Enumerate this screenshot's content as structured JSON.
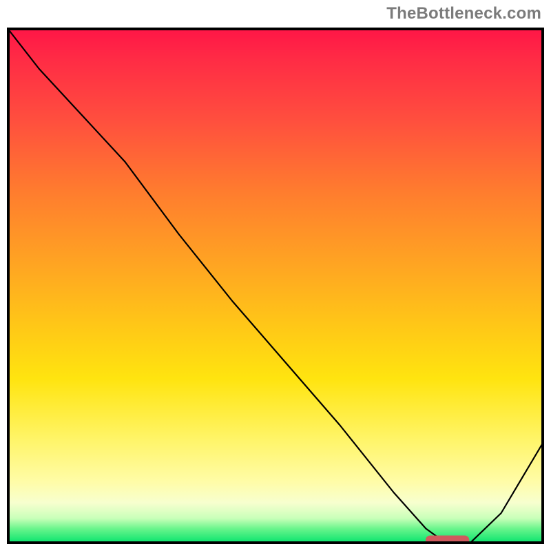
{
  "watermark": "TheBottleneck.com",
  "chart_data": {
    "type": "line",
    "title": "",
    "xlabel": "",
    "ylabel": "",
    "xlim": [
      0,
      100
    ],
    "ylim": [
      0,
      100
    ],
    "grid": false,
    "legend": false,
    "gradient_stops": [
      {
        "pct": 0,
        "color": "#ff1547"
      },
      {
        "pct": 18,
        "color": "#ff4f3e"
      },
      {
        "pct": 46,
        "color": "#ffa522"
      },
      {
        "pct": 68,
        "color": "#ffe40f"
      },
      {
        "pct": 88,
        "color": "#fffca8"
      },
      {
        "pct": 97,
        "color": "#6af58c"
      },
      {
        "pct": 100,
        "color": "#00e26b"
      }
    ],
    "series": [
      {
        "name": "bottleneck-curve",
        "x": [
          0,
          6,
          14,
          22,
          32,
          42,
          52,
          62,
          72,
          78,
          82,
          86,
          92,
          100
        ],
        "y": [
          100,
          92,
          83,
          74,
          60,
          47,
          35,
          23,
          10,
          3,
          0,
          0,
          6,
          20
        ]
      }
    ],
    "optimum_marker": {
      "x_start": 78,
      "x_end": 86,
      "y": 0,
      "color": "#d05a5e"
    }
  }
}
